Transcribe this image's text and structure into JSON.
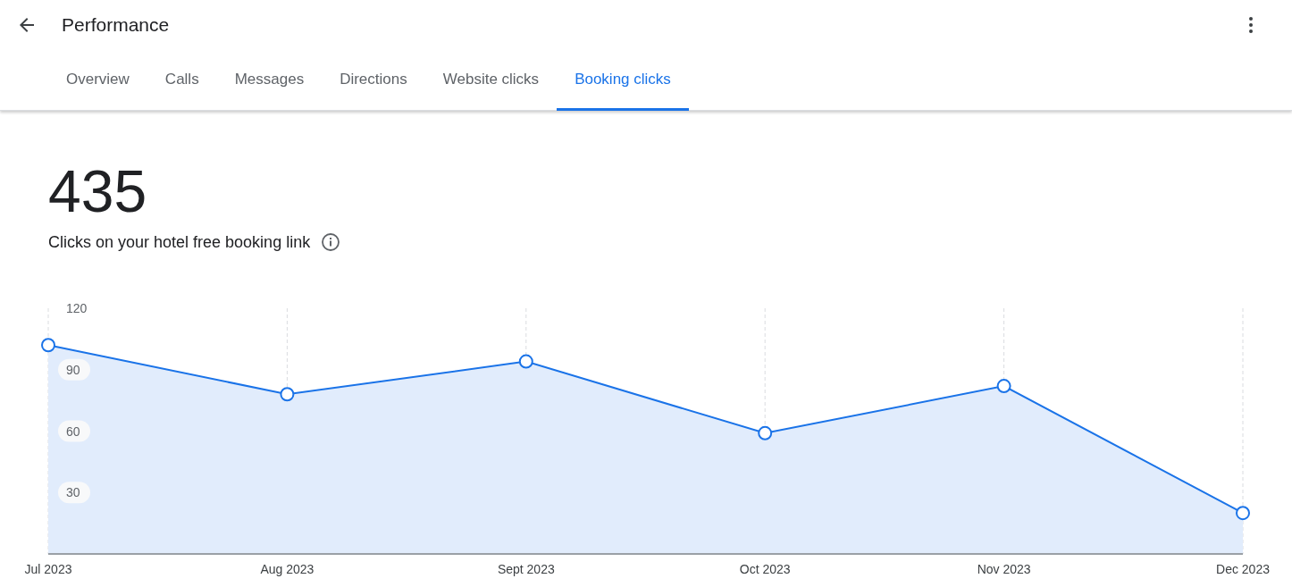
{
  "header": {
    "title": "Performance"
  },
  "tabs": [
    {
      "label": "Overview",
      "selected": false
    },
    {
      "label": "Calls",
      "selected": false
    },
    {
      "label": "Messages",
      "selected": false
    },
    {
      "label": "Directions",
      "selected": false
    },
    {
      "label": "Website clicks",
      "selected": false
    },
    {
      "label": "Booking clicks",
      "selected": true
    }
  ],
  "metric": {
    "value": "435",
    "description": "Clicks on your hotel free booking link"
  },
  "chart_data": {
    "type": "area",
    "categories": [
      "Jul 2023",
      "Aug 2023",
      "Sept 2023",
      "Oct 2023",
      "Nov 2023",
      "Dec 2023"
    ],
    "series": [
      {
        "color": "#1a73e8",
        "values": [
          102,
          78,
          94,
          59,
          82,
          20
        ]
      }
    ],
    "grid": true,
    "ylim": [
      0,
      120
    ],
    "yticks": [
      30,
      60,
      90,
      120
    ]
  }
}
